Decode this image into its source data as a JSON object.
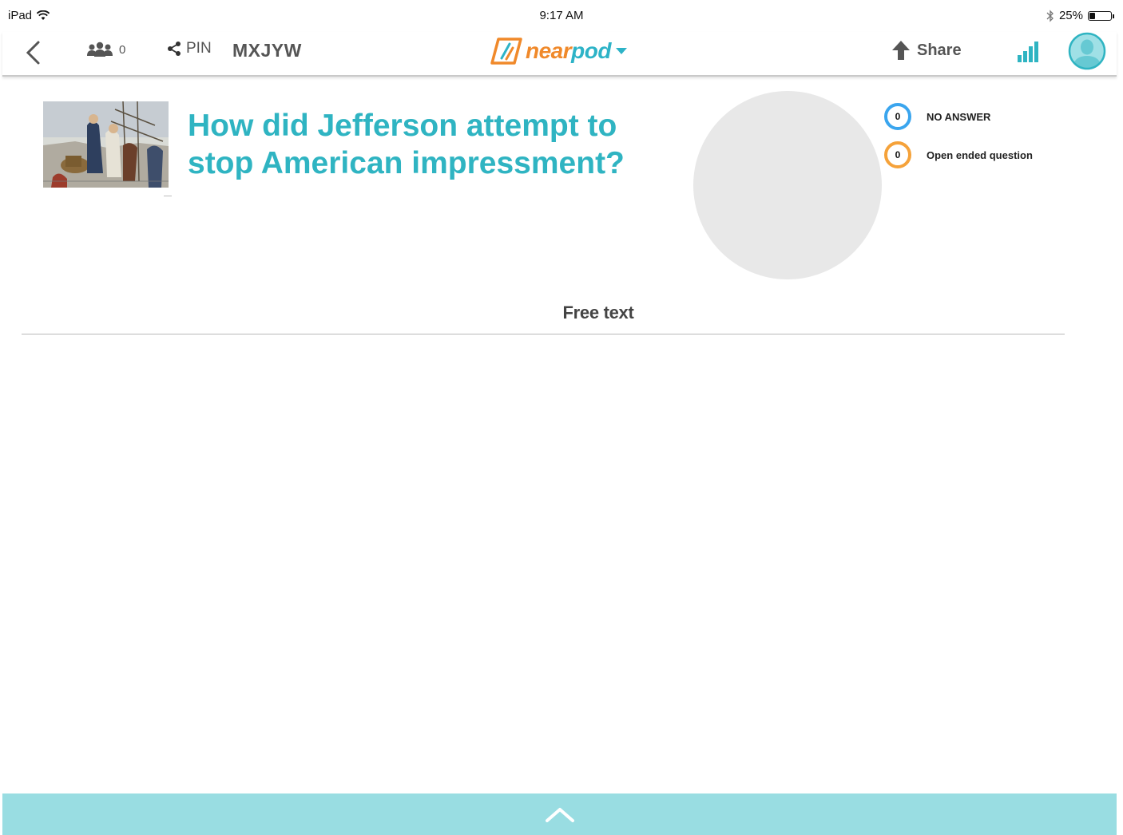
{
  "status_bar": {
    "device": "iPad",
    "time": "9:17 AM",
    "battery": "25%",
    "battery_level": 0.25
  },
  "nav": {
    "students_count": "0",
    "pin_label": "PIN",
    "session_code": "MXJYW",
    "logo_text_near": "near",
    "logo_text_pod": "pod",
    "share_label": "Share",
    "accent_color": "#2fb4c2",
    "logo_color": "#f0892a"
  },
  "slide": {
    "question_line1": "How did Jefferson attempt to",
    "question_line2": "stop American impressment?",
    "image_alt": "illustration of sailors being impressed on a dock"
  },
  "results": {
    "legend": [
      {
        "count": "0",
        "label": "NO ANSWER",
        "color": "#3aa5ee"
      },
      {
        "count": "0",
        "label": "Open ended question",
        "color": "#f5a23a"
      }
    ],
    "section_title": "Free text",
    "pie_color": "#e8e8e8"
  },
  "bottom_bar": {
    "icon": "chevron-up-icon",
    "color": "#99dde2"
  }
}
